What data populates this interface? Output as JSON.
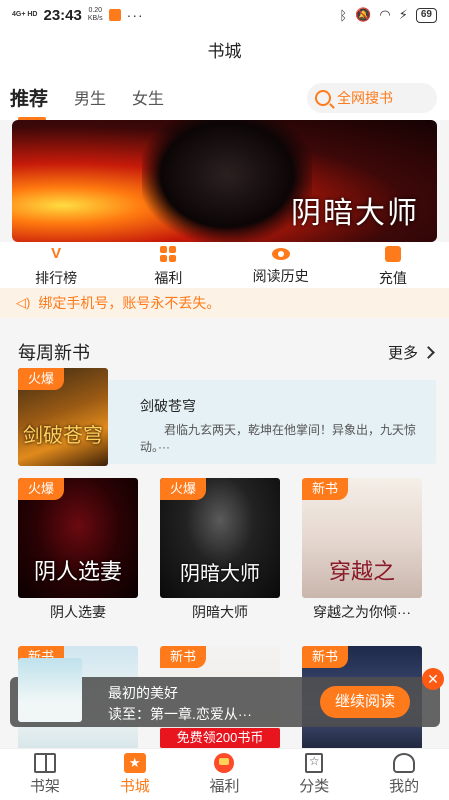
{
  "status_bar": {
    "network": "4G+ HD",
    "time": "23:43",
    "speed": "0.20",
    "speed_unit": "KB/s",
    "more": "···",
    "battery": "69"
  },
  "header": {
    "title": "书城"
  },
  "tabs": [
    {
      "label": "推荐",
      "active": true
    },
    {
      "label": "男生",
      "active": false
    },
    {
      "label": "女生",
      "active": false
    }
  ],
  "search": {
    "label": "全网搜书"
  },
  "banner": {
    "title": "阴暗大师"
  },
  "quick_nav": [
    {
      "label": "排行榜",
      "icon": "ranking-icon"
    },
    {
      "label": "福利",
      "icon": "grid-icon"
    },
    {
      "label": "阅读历史",
      "icon": "eye-icon"
    },
    {
      "label": "充值",
      "icon": "coin-icon"
    }
  ],
  "notice": {
    "text": "绑定手机号，账号永不丢失。"
  },
  "weekly": {
    "title": "每周新书",
    "more": "更多",
    "featured": {
      "badge": "火爆",
      "cover_text": "剑破苍穹",
      "title": "剑破苍穹",
      "desc": "君临九玄两天，乾坤在他掌间！异象出，九天惊动。···"
    },
    "books_row1": [
      {
        "badge": "火爆",
        "cover_text": "阴人选妻",
        "title": "阴人选妻"
      },
      {
        "badge": "火爆",
        "cover_text": "阴暗大师",
        "title": "阴暗大师"
      },
      {
        "badge": "新书",
        "cover_text": "穿越之",
        "title": "穿越之为你倾···"
      }
    ],
    "books_row2": [
      {
        "badge": "新书"
      },
      {
        "badge": "新书"
      },
      {
        "badge": "新书"
      }
    ]
  },
  "continue_reading": {
    "book_title": "最初的美好",
    "progress": "读至：第一章.恋爱从···",
    "button": "继续阅读",
    "close": "✕"
  },
  "free_coupon": "免费领200书币",
  "tab_bar": [
    {
      "label": "书架",
      "active": false
    },
    {
      "label": "书城",
      "active": true
    },
    {
      "label": "福利",
      "active": false
    },
    {
      "label": "分类",
      "active": false
    },
    {
      "label": "我的",
      "active": false
    }
  ],
  "colors": {
    "accent": "#ff7a1a",
    "notice_bg": "#fdf2e6",
    "coupon": "#e8141e"
  }
}
